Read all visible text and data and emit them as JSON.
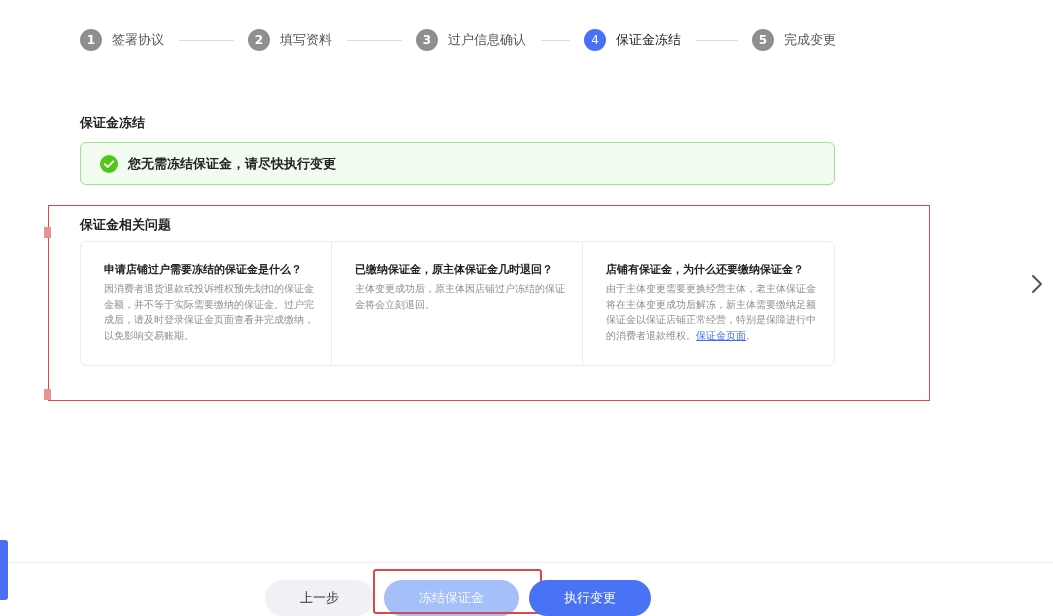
{
  "steps": [
    {
      "number": "1",
      "label": "签署协议",
      "selected": false
    },
    {
      "number": "2",
      "label": "填写资料",
      "selected": false
    },
    {
      "number": "3",
      "label": "过户信息确认",
      "selected": false
    },
    {
      "number": "4",
      "label": "保证金冻结",
      "selected": true
    },
    {
      "number": "5",
      "label": "完成变更",
      "selected": false
    }
  ],
  "freeze_section": {
    "title": "保证金冻结",
    "alert": {
      "kind": "success",
      "message": "您无需冻结保证金，请尽快执行变更"
    }
  },
  "faq_section": {
    "title": "保证金相关问题",
    "annotated": true,
    "cards": [
      {
        "question": "申请店铺过户需要冻结的保证金是什么？",
        "answer": "因消费者退货退款或投诉维权预先划扣的保证金金额，并不等于实际需要缴纳的保证金。过户完成后，请及时登录保证金页面查看并完成缴纳，以免影响交易账期。"
      },
      {
        "question": "已缴纳保证金，原主体保证金几时退回？",
        "answer": "主体变更成功后，原主体因店铺过户冻结的保证金将会立刻退回。"
      },
      {
        "question": "店铺有保证金，为什么还要缴纳保证金？",
        "answer": "由于主体变更需要更换经营主体，老主体保证金将在主体变更成功后解冻，新主体需要缴纳足额保证金以保证店铺正常经营，特别是保障进行中的消费者退款维权。",
        "link": "保证金页面",
        "answer_after_link": "。"
      }
    ]
  },
  "buttons": [
    {
      "label": "上一步",
      "kind": "secondary",
      "disabled": false,
      "annotated": false
    },
    {
      "label": "冻结保证金",
      "kind": "primary",
      "disabled": true,
      "annotated": true
    },
    {
      "label": "执行变更",
      "kind": "primary",
      "disabled": false,
      "annotated": false
    }
  ]
}
